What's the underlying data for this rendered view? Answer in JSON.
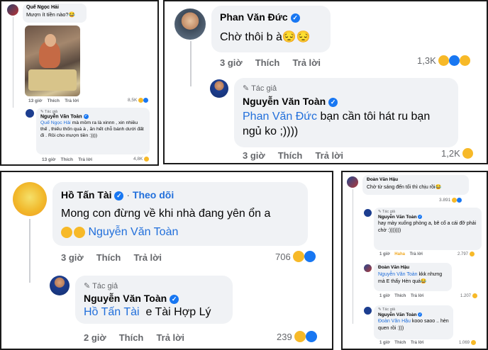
{
  "p1": {
    "c1": {
      "name": "Quế Ngọc Hải",
      "text": "Mượn ít tiền nào?😂",
      "time": "13 giờ",
      "like": "Thích",
      "reply": "Trả lời",
      "count": "8,5K"
    },
    "c2": {
      "badge": "Tác giả",
      "name": "Nguyễn Văn Toàn",
      "mention": "Quế Ngọc Hải",
      "text": " mà mồm ra là xinnn , xin nhiều thế , thiếu thốn quá à , ăn hết chỗ bánh dưới đất đi . Rồi cho mượn tiền :))))",
      "time": "13 giờ",
      "like": "Thích",
      "reply": "Trả lời",
      "count": "4,8K"
    }
  },
  "p2": {
    "c1": {
      "name": "Phan Văn Đức",
      "text": "Chờ thôi b à😔😔",
      "time": "3 giờ",
      "like": "Thích",
      "reply": "Trả lời",
      "count": "1,3K"
    },
    "c2": {
      "badge": "Tác giả",
      "name": "Nguyễn Văn Toàn",
      "mention": "Phan Văn Đức",
      "text": " bạn cần tôi hát ru bạn ngủ ko ;))))",
      "time": "3 giờ",
      "like": "Thích",
      "reply": "Trả lời",
      "count": "1,2K"
    }
  },
  "p3": {
    "c1": {
      "name": "Hồ Tấn Tài",
      "follow": "Theo dõi",
      "text": "Mong con đừng về khi nhà đang yên ổn a",
      "mention": "Nguyễn Văn Toàn",
      "time": "3 giờ",
      "like": "Thích",
      "reply": "Trả lời",
      "count": "706"
    },
    "c2": {
      "badge": "Tác giả",
      "name": "Nguyễn Văn Toàn",
      "mention": "Hồ Tấn Tài",
      "text": "e Tài Hợp Lý",
      "time": "2 giờ",
      "like": "Thích",
      "reply": "Trả lời",
      "count": "239"
    }
  },
  "p4": {
    "c1": {
      "name": "Đoàn Văn Hậu",
      "text": "Chờ từ sáng đến tối thì chịu rồi😂",
      "count": "3.891"
    },
    "c2": {
      "badge": "Tác giả",
      "name": "Nguyễn Văn Toàn",
      "text": "hay mày xuống phòng a, bê cổ a cái đỡ phải chờ :)))))))",
      "time": "1 giờ",
      "haha": "Haha",
      "reply": "Trả lời",
      "count": "2.797"
    },
    "c3": {
      "name": "Đoàn Văn Hậu",
      "mention": "Nguyễn Văn Toàn",
      "text": " kkk nhưng mà E thấy Hèn quá😂",
      "time": "1 giờ",
      "like": "Thích",
      "reply": "Trả lời",
      "count": "1.207"
    },
    "c4": {
      "badge": "Tác giả",
      "name": "Nguyễn Văn Toàn",
      "mention": "Đoàn Văn Hậu",
      "text": " kooo saoo .. hèn quen rồi :)))",
      "time": "1 giờ",
      "like": "Thích",
      "reply": "Trả lời",
      "count": "1.069"
    }
  },
  "colors": {
    "mention": "#216fdb",
    "bubble": "#f0f2f5",
    "verified": "#1877f2",
    "haha": "#f7b928"
  }
}
